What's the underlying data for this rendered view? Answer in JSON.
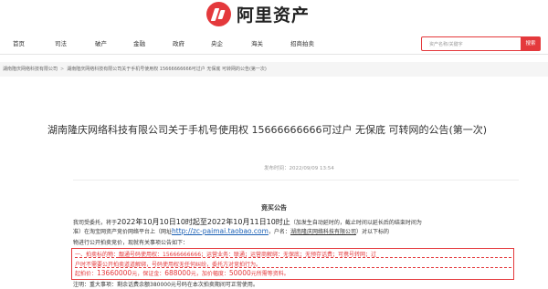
{
  "header": {
    "logo_text": "阿里资产",
    "brand_color": "#e4393c"
  },
  "nav": {
    "items": [
      "首页",
      "司法",
      "破产",
      "金融",
      "政府",
      "央企",
      "海关",
      "招商拍卖"
    ],
    "search_placeholder": "资产名称/关键字",
    "search_button": "搜索"
  },
  "breadcrumb": {
    "items": [
      "湖南隆庆网络科技有限公司",
      "湖南隆庆网络科技有限公司关于手机号使用权 15666666666可过户 无保底 可转网的公告(第一次)"
    ]
  },
  "article": {
    "title": "湖南隆庆网络科技有限公司关于手机号使用权 15666666666可过户 无保底 可转网的公告(第一次)",
    "published": "发布时间：2022/09/09 13:54",
    "notice_heading": "竞买公告",
    "p1_a": "我司受委托，将于",
    "p1_date1": "2022年10月10日10时起至2022年10月11日10时止",
    "p1_b": "（加发生自动延时的，截止时间以延长后的结束时间为",
    "p2_a": "准）在淘宝网资产竞价网络平台上（网址",
    "p2_url": "http://zc-paimai.taobao.com",
    "p2_b": "，户名：",
    "p2_name": "湖南隆庆网络科技有限公司",
    "p2_c": "）对以下标的",
    "p3": "物进行公开拍卖竞价，现就有关事项公告如下：",
    "red1_a": "一、拍卖标的物：",
    "red1_num": "靓通号码使用权：15666666666",
    "red1_b": "；运营业务：联通；运营商解绑：无保底；无预存话费；可携号转网；过",
    "red2": "户时不需要公开拍卖道道解绑，号码使用权无任何纠纷，委托方对竞拍行为。",
    "red3_a": "起拍价：",
    "red3_price": "13660000",
    "red3_b": "元，保证金：",
    "red3_deposit": "688000",
    "red3_c": "元，加价幅度：",
    "red3_step": "50000",
    "red3_d": "元所需等资料。",
    "p4_a": "注明：",
    "p4_b": "重大事项：剩余话费余额380000元号码在本次拍卖期间可正常使用。"
  }
}
